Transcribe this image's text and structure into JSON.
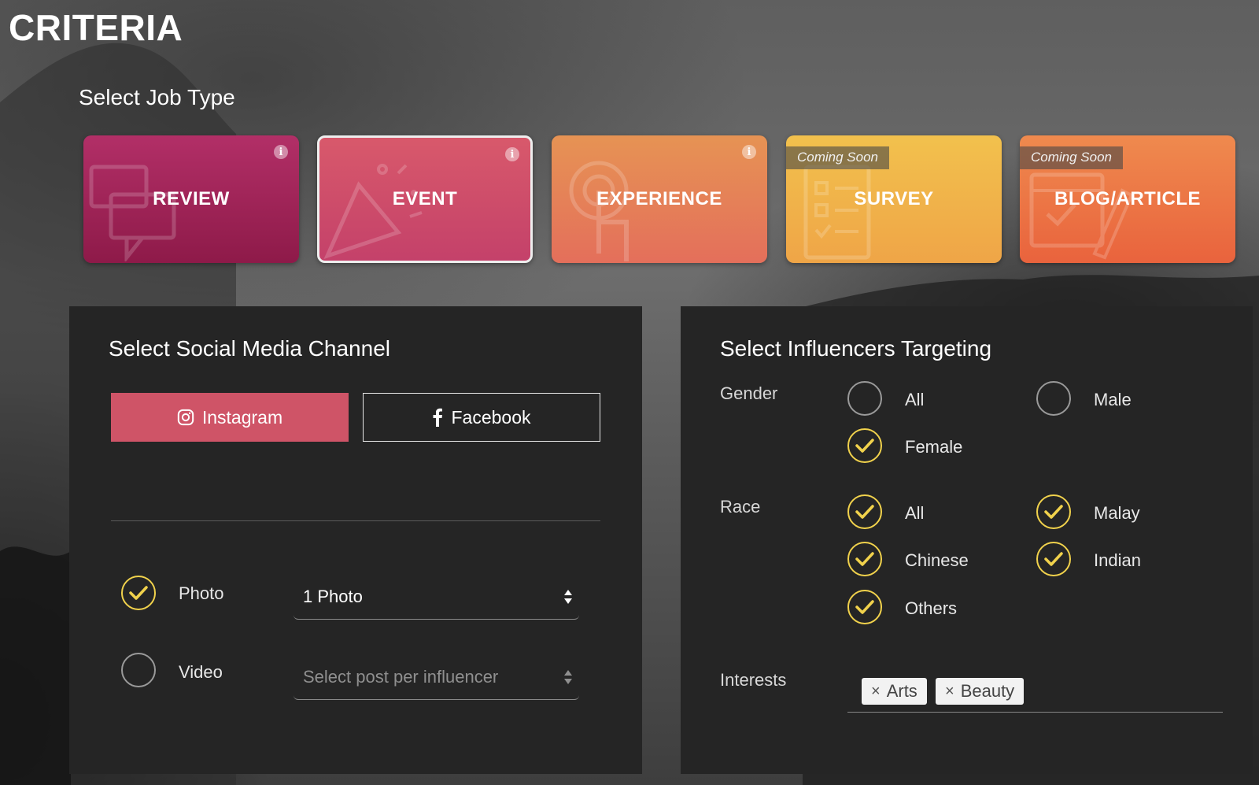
{
  "page": {
    "title": "CRITERIA"
  },
  "job_type": {
    "heading": "Select Job Type",
    "cards": [
      {
        "label": "REVIEW",
        "icon": "chat-bubbles-icon",
        "badge": "",
        "selected": false
      },
      {
        "label": "EVENT",
        "icon": "party-popper-icon",
        "badge": "",
        "selected": true
      },
      {
        "label": "EXPERIENCE",
        "icon": "tap-hand-icon",
        "badge": "",
        "selected": false
      },
      {
        "label": "SURVEY",
        "icon": "checklist-icon",
        "badge": "Coming Soon",
        "selected": false
      },
      {
        "label": "BLOG/ARTICLE",
        "icon": "edit-document-icon",
        "badge": "Coming Soon",
        "selected": false
      }
    ],
    "info_glyph": "i"
  },
  "social": {
    "heading": "Select Social Media Channel",
    "instagram_label": "Instagram",
    "facebook_label": "Facebook",
    "active_channel": "Instagram",
    "photo": {
      "label": "Photo",
      "checked": true,
      "select_value": "1 Photo"
    },
    "video": {
      "label": "Video",
      "checked": false,
      "select_placeholder": "Select post per influencer"
    }
  },
  "targeting": {
    "heading": "Select Influencers Targeting",
    "gender": {
      "label": "Gender",
      "options": [
        {
          "label": "All",
          "checked": false
        },
        {
          "label": "Male",
          "checked": false
        },
        {
          "label": "Female",
          "checked": true
        }
      ]
    },
    "race": {
      "label": "Race",
      "options": [
        {
          "label": "All",
          "checked": true
        },
        {
          "label": "Malay",
          "checked": true
        },
        {
          "label": "Chinese",
          "checked": true
        },
        {
          "label": "Indian",
          "checked": true
        },
        {
          "label": "Others",
          "checked": true
        }
      ]
    },
    "interests": {
      "label": "Interests",
      "tags": [
        "Arts",
        "Beauty"
      ],
      "remove_glyph": "×"
    }
  },
  "colors": {
    "accent_pink": "#cf5467",
    "check_yellow": "#f1d24c",
    "panel_bg": "#252525"
  }
}
